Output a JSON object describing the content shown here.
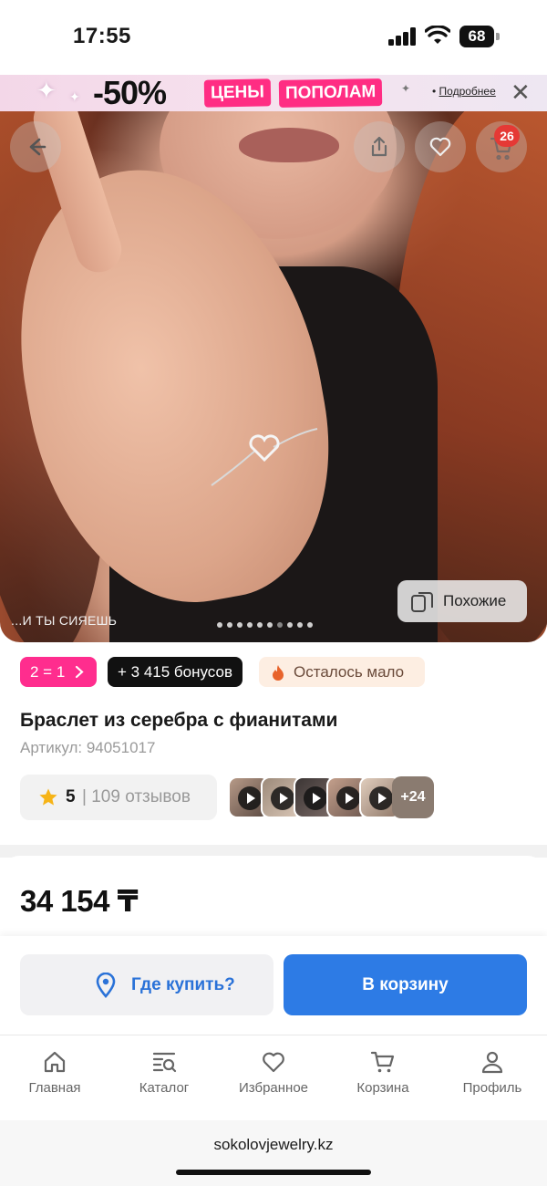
{
  "status_bar": {
    "time": "17:55",
    "battery": "68"
  },
  "promo_banner": {
    "discount": "-50%",
    "tag_1": "ЦЕНЫ",
    "tag_2": "ПОПОЛАМ",
    "more_prefix": "•",
    "more_link": "Подробнее",
    "close_icon": "close-icon"
  },
  "hero": {
    "caption": "...И ТЫ СИЯЕШЬ",
    "dots_total": 10,
    "active_dot": 6,
    "cart_count": "26",
    "similar_label": "Похожие"
  },
  "chips": {
    "promo": "2 = 1",
    "bonus": "+ 3 415 бонусов",
    "low_stock": "Осталось мало"
  },
  "product": {
    "title": "Браслет из серебра с фианитами",
    "article": "Артикул: 94051017",
    "rating": "5",
    "reviews": "| 109 отзывов",
    "more_media": "+24",
    "price": "34 154 ₸"
  },
  "actions": {
    "where_to_buy": "Где купить?",
    "add_to_cart": "В корзину"
  },
  "tabbar": [
    {
      "label": "Главная",
      "icon": "home-icon"
    },
    {
      "label": "Каталог",
      "icon": "catalog-icon"
    },
    {
      "label": "Избранное",
      "icon": "heart-icon"
    },
    {
      "label": "Корзина",
      "icon": "cart-icon"
    },
    {
      "label": "Профиль",
      "icon": "user-icon"
    }
  ],
  "browser": {
    "url": "sokolovjewelry.kz"
  },
  "colors": {
    "accent_blue": "#2d7be5",
    "promo_pink": "#ff2d8e",
    "low_stock_bg": "#fdeee2",
    "badge_red": "#e53935"
  }
}
